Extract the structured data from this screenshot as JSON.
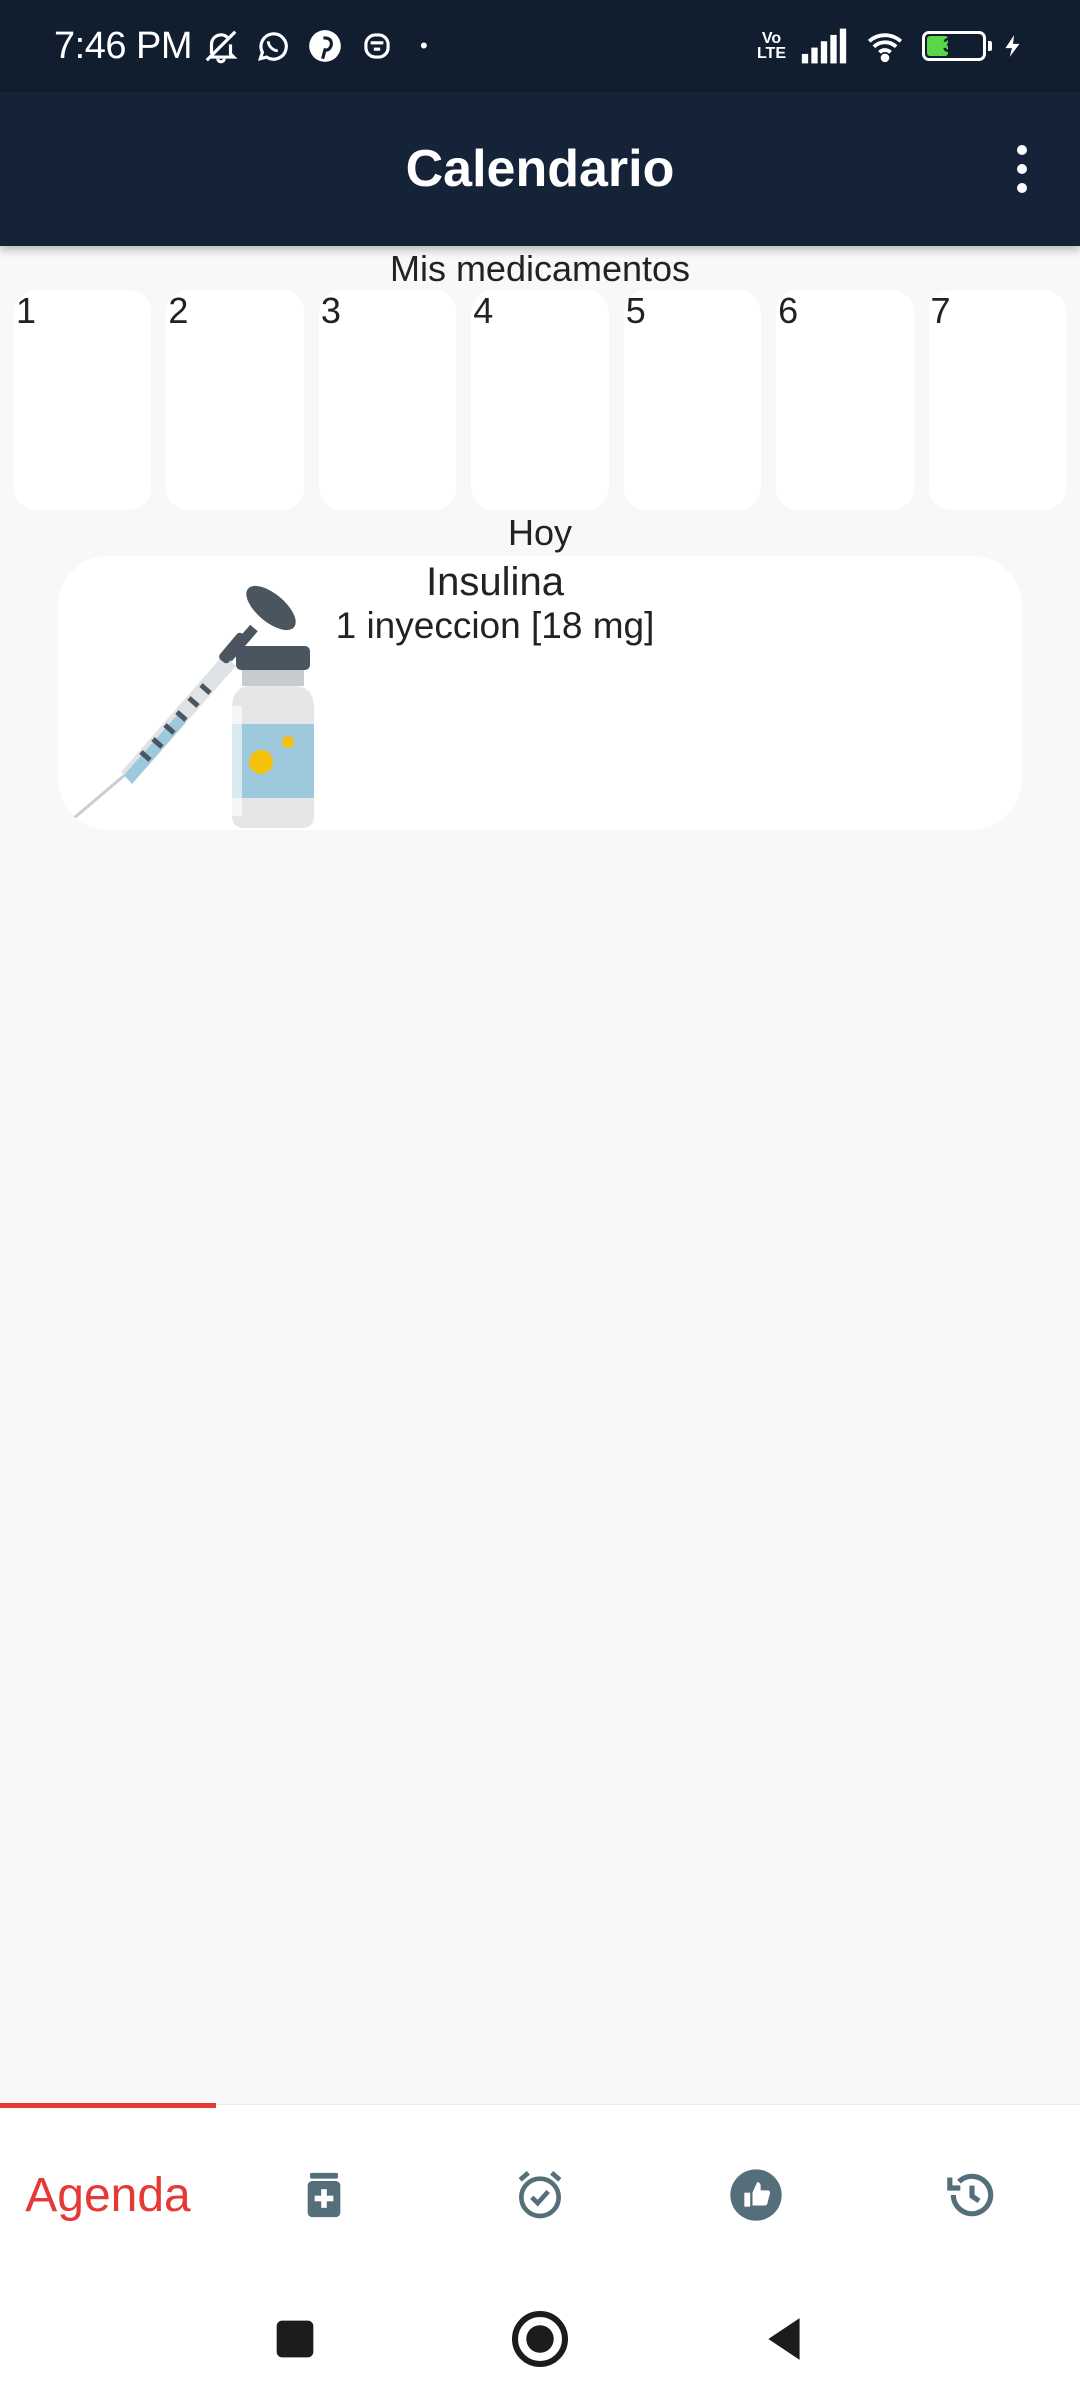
{
  "status_bar": {
    "time": "7:46 PM",
    "dot": "•",
    "network_label": "Vo\nLTE",
    "battery_level": "38",
    "battery_fraction": 0.38,
    "icons_left": [
      "notifications-muted-icon",
      "whatsapp-icon",
      "pinterest-icon",
      "app-notification-icon"
    ],
    "icons_right": [
      "volte-icon",
      "signal-icon",
      "wifi-icon",
      "battery-icon",
      "charging-icon"
    ]
  },
  "app_bar": {
    "title": "Calendario",
    "menu_icon": "more-vert-icon"
  },
  "main": {
    "section_title": "Mis medicamentos",
    "days": [
      "1",
      "2",
      "3",
      "4",
      "5",
      "6",
      "7"
    ],
    "today_label": "Hoy",
    "medication": {
      "name": "Insulina",
      "dose": "1 inyeccion [18 mg]",
      "image_icon": "syringe-vial-icon"
    }
  },
  "bottom_nav": {
    "items": [
      {
        "label": "Agenda",
        "icon": "agenda",
        "active": true
      },
      {
        "label": "",
        "icon": "medication-box-icon",
        "active": false
      },
      {
        "label": "",
        "icon": "alarm-check-icon",
        "active": false
      },
      {
        "label": "",
        "icon": "thumb-up-icon",
        "active": false
      },
      {
        "label": "",
        "icon": "history-icon",
        "active": false
      }
    ]
  },
  "system_nav": {
    "buttons": [
      "recents-square-icon",
      "home-circle-icon",
      "back-triangle-icon"
    ]
  },
  "colors": {
    "status_bar_bg": "#111e30",
    "app_bar_bg": "#142338",
    "accent": "#e53935",
    "nav_icon": "#546e7a",
    "background": "#f8f8f8"
  }
}
